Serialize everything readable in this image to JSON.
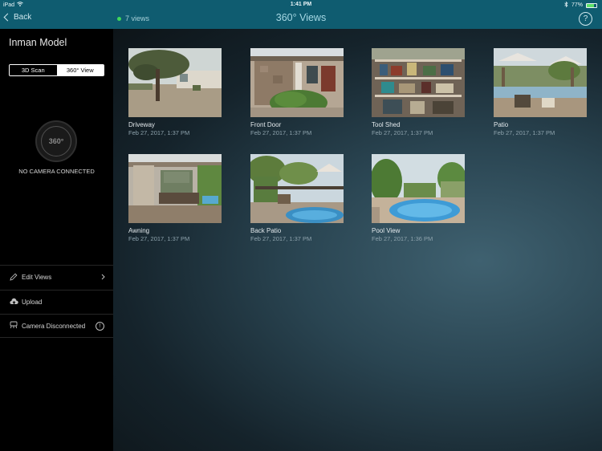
{
  "status_bar": {
    "carrier": "iPad",
    "time": "1:41 PM",
    "battery": "77%",
    "battery_level": 0.77
  },
  "nav": {
    "back_label": "Back",
    "views_count": "7 views",
    "title": "360° Views",
    "help_label": "?"
  },
  "sidebar": {
    "model_name": "Inman Model",
    "segments": [
      {
        "label": "3D Scan",
        "selected": false
      },
      {
        "label": "360° View",
        "selected": true
      }
    ],
    "camera_logo": "360°",
    "camera_status": "NO CAMERA CONNECTED",
    "menu": [
      {
        "label": "Edit Views",
        "icon": "pencil-icon",
        "trailing": "chevron-right-icon"
      },
      {
        "label": "Upload",
        "icon": "cloud-upload-icon",
        "trailing": ""
      },
      {
        "label": "Camera Disconnected",
        "icon": "camera-icon",
        "trailing": "info-icon"
      }
    ]
  },
  "views": [
    {
      "name": "Driveway",
      "date": "Feb 27, 2017, 1:37 PM"
    },
    {
      "name": "Front Door",
      "date": "Feb 27, 2017, 1:37 PM"
    },
    {
      "name": "Tool Shed",
      "date": "Feb 27, 2017, 1:37 PM"
    },
    {
      "name": "Patio",
      "date": "Feb 27, 2017, 1:37 PM"
    },
    {
      "name": "Awning",
      "date": "Feb 27, 2017, 1:37 PM"
    },
    {
      "name": "Back Patio",
      "date": "Feb 27, 2017, 1:37 PM"
    },
    {
      "name": "Pool View",
      "date": "Feb 27, 2017, 1:36 PM"
    }
  ]
}
